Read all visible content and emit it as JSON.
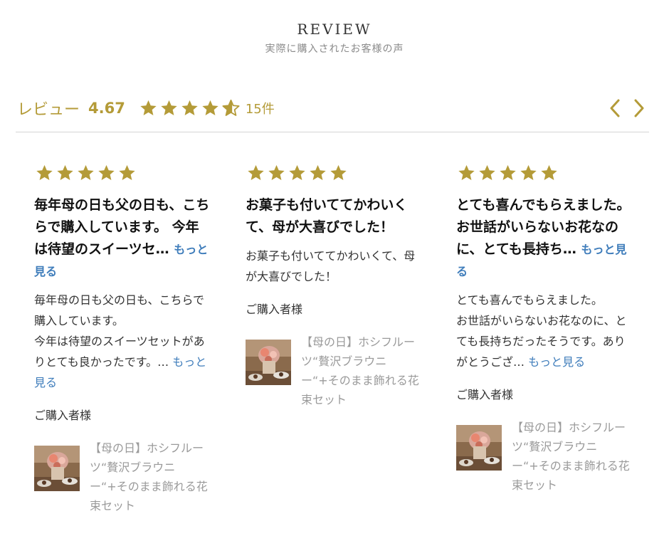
{
  "header": {
    "title": "REVIEW",
    "subtitle": "実際に購入されたお客様の声"
  },
  "summary": {
    "label": "レビュー",
    "score": "4.67",
    "rating": 4.67,
    "count_text": "15件",
    "star_color": "#b49b38"
  },
  "nav": {
    "prev_icon": "chevron-left-icon",
    "next_icon": "chevron-right-icon"
  },
  "colors": {
    "accent": "#b49b38",
    "link": "#3f7dbb",
    "muted": "#9a9a9a"
  },
  "reviews": [
    {
      "rating": 5,
      "title": "毎年母の日も父の日も、こちらで購入しています。 今年は待望のスイーツセ…",
      "title_more": "もっと見る",
      "body": "毎年母の日も父の日も、こちらで購入しています。\n今年は待望のスイーツセットがありとても良かったです。…",
      "body_more": "もっと見る",
      "buyer": "ご購入者様",
      "product": "【母の日】ホシフルーツ“贅沢ブラウニー“+そのまま飾れる花束セット"
    },
    {
      "rating": 5,
      "title": "お菓子も付いててかわいくて、母が大喜びでした！",
      "title_more": "",
      "body": "お菓子も付いててかわいくて、母が大喜びでした！",
      "body_more": "",
      "buyer": "ご購入者様",
      "product": "【母の日】ホシフルーツ“贅沢ブラウニー“+そのまま飾れる花束セット"
    },
    {
      "rating": 5,
      "title": "とても喜んでもらえました。 お世話がいらないお花なのに、とても長持ち…",
      "title_more": "もっと見る",
      "body": "とても喜んでもらえました。\nお世話がいらないお花なのに、とても長持ちだったそうです。ありがとうござ…",
      "body_more": "もっと見る",
      "buyer": "ご購入者様",
      "product": "【母の日】ホシフルーツ“贅沢ブラウニー“+そのまま飾れる花束セット"
    }
  ]
}
